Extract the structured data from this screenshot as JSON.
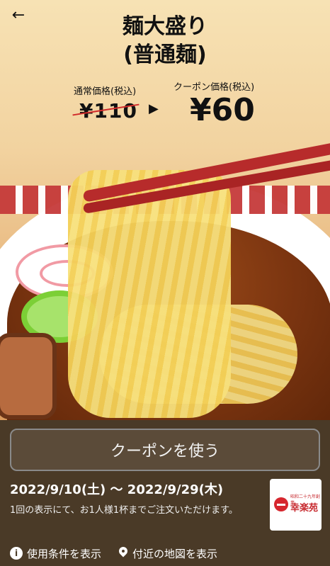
{
  "hero": {
    "title_line1": "麺大盛り",
    "title_line2": "(普通麺)",
    "regular_price_label": "通常価格(税込)",
    "regular_price": "¥110",
    "coupon_price_label": "クーポン価格(税込)",
    "coupon_price": "¥60",
    "back_icon": "arrow-left-icon",
    "price_arrow_icon": "triangle-right-icon"
  },
  "panel": {
    "use_coupon_button": "クーポンを使う",
    "valid_dates": "2022/9/10(土) 〜 2022/9/29(木)",
    "note": "1回の表示にて、お1人様1杯までご注文いただけます。",
    "logo": {
      "small_text": "昭和二十九年創業",
      "brand_text": "幸楽苑"
    },
    "footer_links": [
      {
        "label": "使用条件を表示",
        "icon": "info-icon"
      },
      {
        "label": "付近の地図を表示",
        "icon": "map-pin-icon"
      }
    ]
  },
  "colors": {
    "panel_bg": "#4a3a27",
    "strike": "#d12b2b",
    "brand_red": "#d6262e"
  }
}
